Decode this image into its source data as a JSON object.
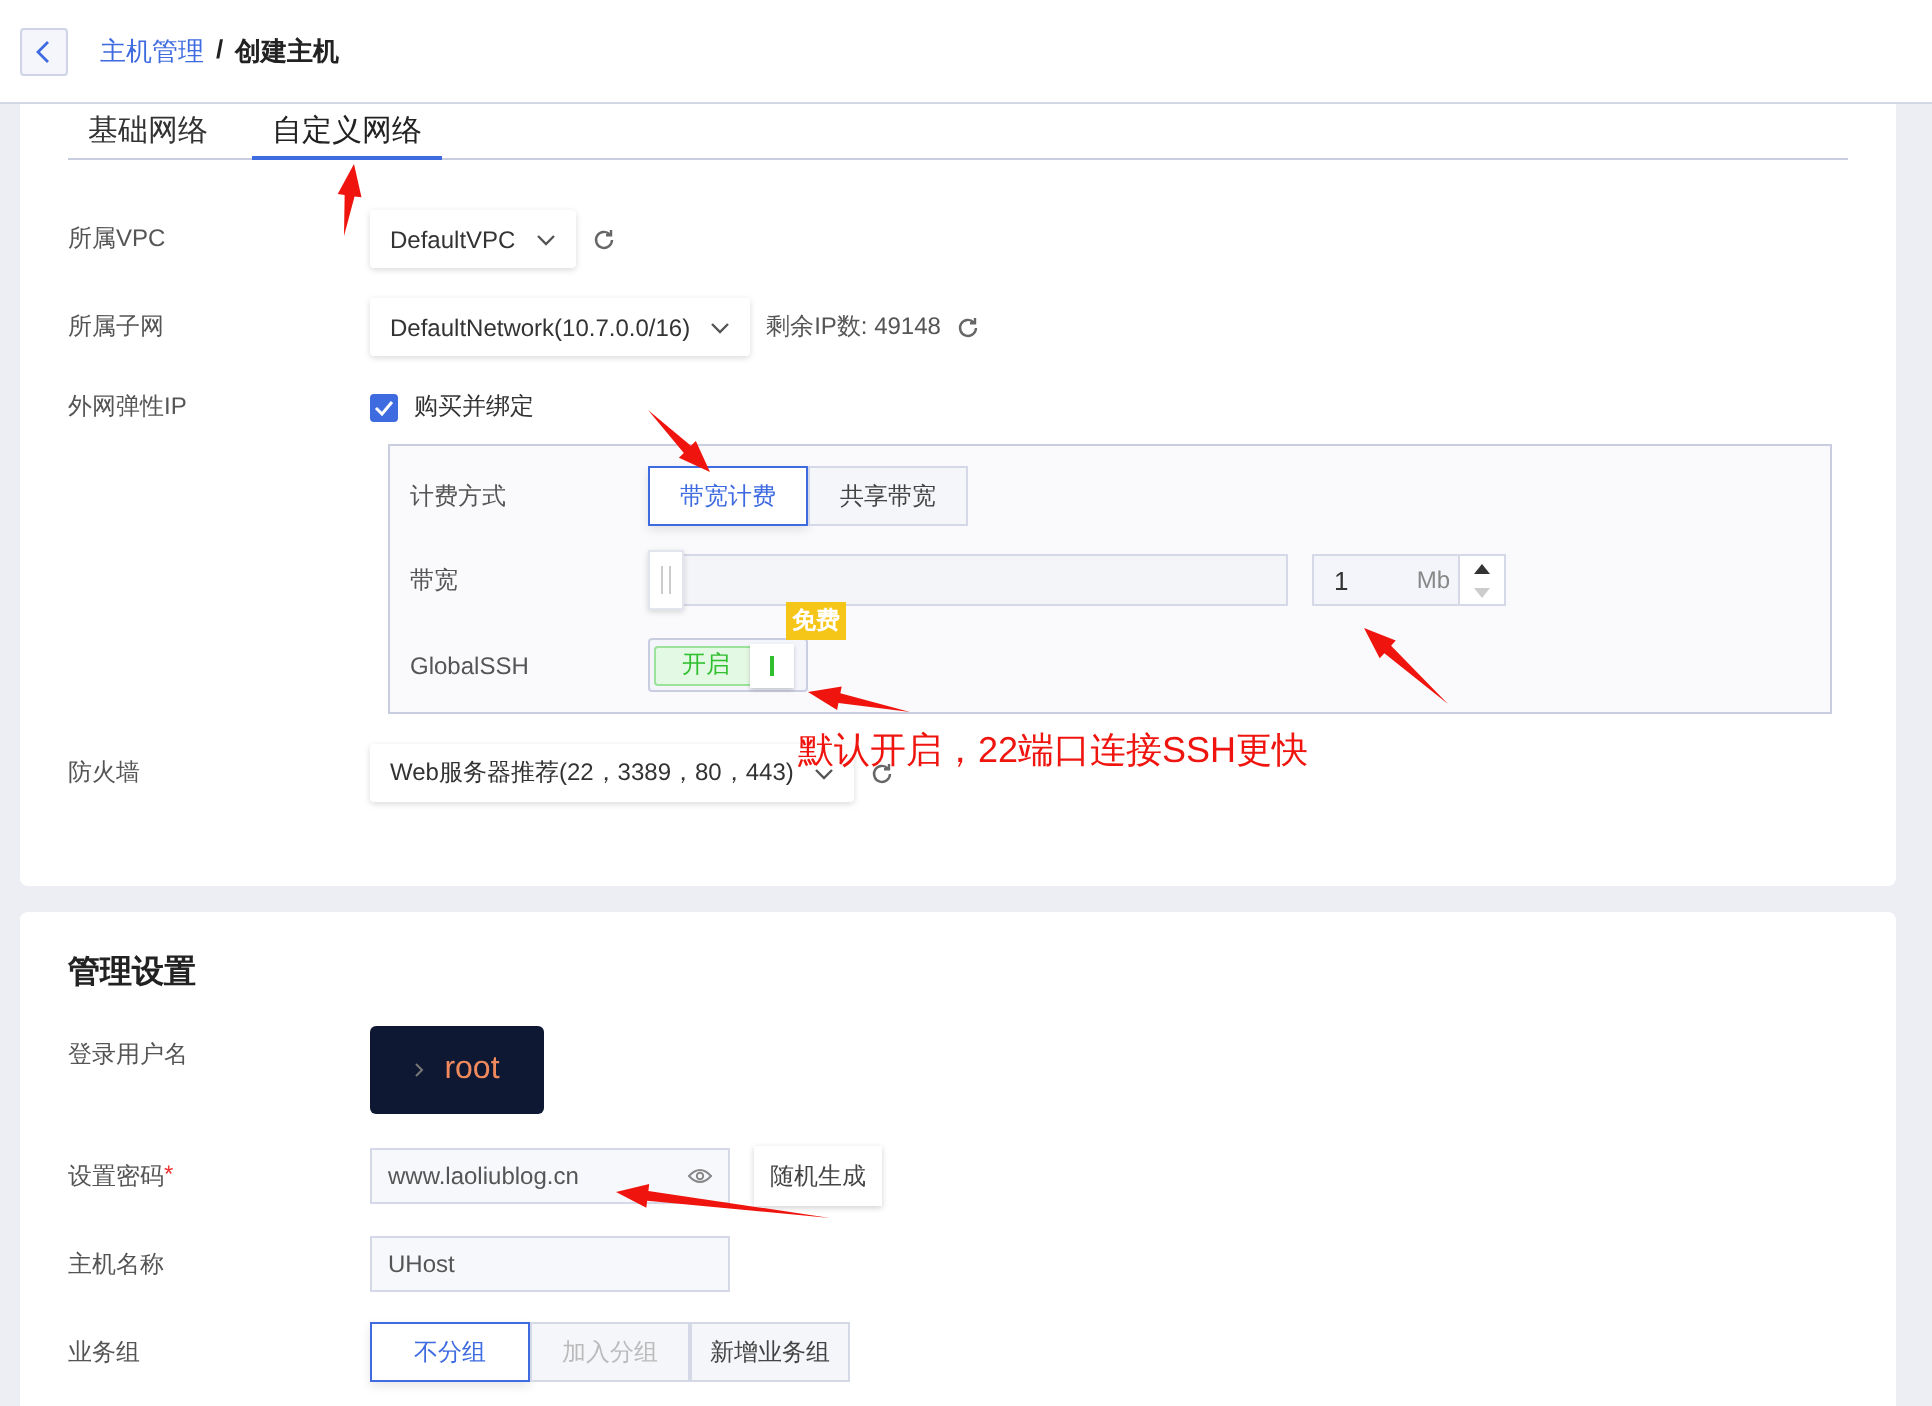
{
  "header": {
    "breadcrumb": {
      "parent": "主机管理",
      "separator": "/",
      "current": "创建主机"
    }
  },
  "network": {
    "tabs": [
      {
        "label": "基础网络",
        "selected": false
      },
      {
        "label": "自定义网络",
        "selected": true
      }
    ],
    "vpc": {
      "label": "所属VPC",
      "value": "DefaultVPC"
    },
    "subnet": {
      "label": "所属子网",
      "value": "DefaultNetwork(10.7.0.0/16)",
      "remaining": "剩余IP数: 49148"
    },
    "eip": {
      "label": "外网弹性IP",
      "checked": true,
      "checkbox_label": "购买并绑定"
    },
    "billing": {
      "label": "计费方式",
      "options": [
        {
          "label": "带宽计费",
          "selected": true
        },
        {
          "label": "共享带宽",
          "selected": false
        }
      ]
    },
    "bandwidth": {
      "label": "带宽",
      "level": 0,
      "value": "1",
      "unit": "Mb"
    },
    "globalssh": {
      "label": "GlobalSSH",
      "on": true,
      "state_text": "开启",
      "badge": "免费"
    },
    "annotation": "默认开启，22端口连接SSH更快",
    "firewall": {
      "label": "防火墙",
      "value": "Web服务器推荐(22，3389，80，443)"
    }
  },
  "management": {
    "title": "管理设置",
    "username": {
      "label": "登录用户名",
      "value": "root"
    },
    "password": {
      "label": "设置密码",
      "required_mark": "*",
      "value": "www.laoliublog.cn",
      "generate_button": "随机生成"
    },
    "hostname": {
      "label": "主机名称",
      "value": "UHost"
    },
    "group": {
      "label": "业务组",
      "options": [
        {
          "label": "不分组",
          "selected": true,
          "disabled": false
        },
        {
          "label": "加入分组",
          "selected": false,
          "disabled": true
        },
        {
          "label": "新增业务组",
          "selected": false,
          "disabled": false
        }
      ]
    }
  }
}
